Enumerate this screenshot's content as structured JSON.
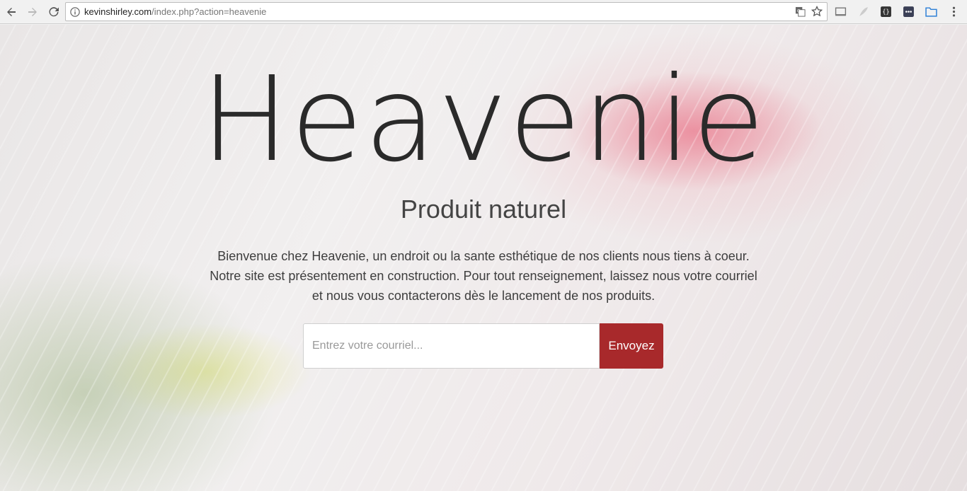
{
  "browser": {
    "url_host": "kevinshirley.com",
    "url_path": "/index.php?action=heavenie"
  },
  "hero": {
    "title": "Heavenie",
    "subtitle": "Produit naturel",
    "paragraph_lines": [
      "Bienvenue chez Heavenie, un endroit ou la sante esthétique de nos clients nous tiens à coeur.",
      "Notre site est présentement en construction. Pour tout renseignement, laissez nous votre courriel",
      "et nous vous contacterons dès le lancement de nos produits."
    ],
    "email_placeholder": "Entrez votre courriel...",
    "submit_label": "Envoyez"
  },
  "colors": {
    "accent": "#a8292b"
  }
}
